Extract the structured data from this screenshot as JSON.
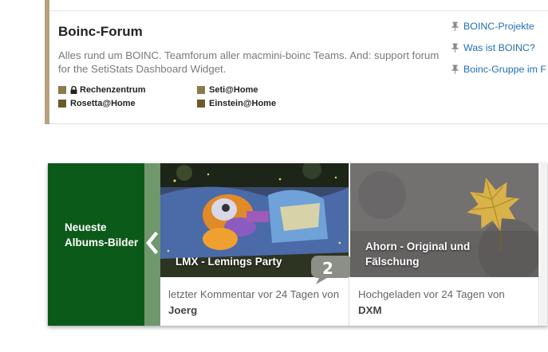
{
  "forum": {
    "title": "Boinc-Forum",
    "description": "Alles rund um BOINC. Teamforum aller macmini-boinc Teams. And: support forum for the SetiStats Dashboard Widget.",
    "subforums": [
      {
        "label": "Rechenzentrum",
        "locked": true,
        "color": "#8a7a4e"
      },
      {
        "label": "Seti@Home",
        "locked": false,
        "color": "#8a7a4e"
      },
      {
        "label": "Rosetta@Home",
        "locked": false,
        "color": "#6b5a2a"
      },
      {
        "label": "Einstein@Home",
        "locked": false,
        "color": "#6b5a2a"
      }
    ],
    "threads": [
      {
        "label": "BOINC-Projekte"
      },
      {
        "label": "Was ist BOINC?"
      },
      {
        "label": "Boinc-Gruppe im F"
      }
    ]
  },
  "albums": {
    "panel_label": "Neueste Albums-Bilder",
    "cards": [
      {
        "caption": "LMX - Lemings Party",
        "meta_prefix": "letzter Kommentar vor 24 Tagen von",
        "user": "Joerg",
        "comment_count": "2"
      },
      {
        "caption": "Ahorn - Original und Fälschung",
        "meta_prefix": "Hochgeladen vor 24 Tagen von",
        "user": "DXM"
      }
    ]
  },
  "colors": {
    "accent": "#b7a27d",
    "link": "#1f6fb4",
    "album_panel": "#0c5a1a",
    "album_prev_strip": "#6f986c"
  },
  "icons": [
    "lock-icon",
    "pin-icon",
    "chevron-left-icon",
    "comment-bubble-icon"
  ]
}
